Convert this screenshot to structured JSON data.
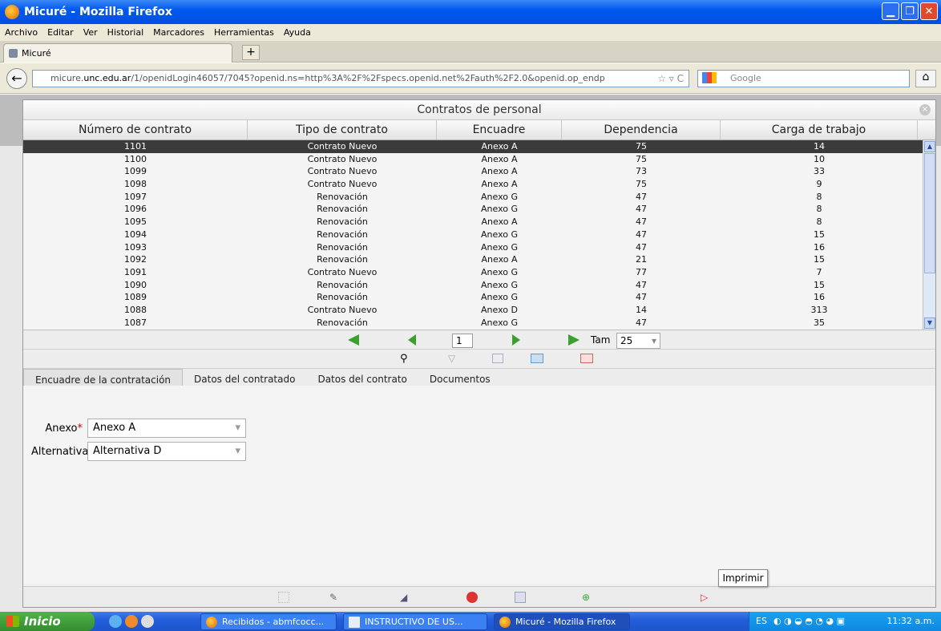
{
  "window": {
    "title": "Micuré - Mozilla Firefox"
  },
  "menu": [
    "Archivo",
    "Editar",
    "Ver",
    "Historial",
    "Marcadores",
    "Herramientas",
    "Ayuda"
  ],
  "browser": {
    "tab_label": "Micuré",
    "new_tab": "+",
    "url_prefix": "micure.",
    "url_domain": "unc.edu.ar",
    "url_rest": "/1/openidLogin46057/7045?openid.ns=http%3A%2F%2Fspecs.openid.net%2Fauth%2F2.0&openid.op_endp",
    "search_placeholder": "Google"
  },
  "dialog": {
    "title": "Contratos de personal",
    "columns": [
      "Número de contrato",
      "Tipo de contrato",
      "Encuadre",
      "Dependencia",
      "Carga de trabajo"
    ],
    "rows": [
      [
        "1101",
        "Contrato Nuevo",
        "Anexo A",
        "75",
        "14"
      ],
      [
        "1100",
        "Contrato Nuevo",
        "Anexo A",
        "75",
        "10"
      ],
      [
        "1099",
        "Contrato Nuevo",
        "Anexo A",
        "73",
        "33"
      ],
      [
        "1098",
        "Contrato Nuevo",
        "Anexo A",
        "75",
        "9"
      ],
      [
        "1097",
        "Renovación",
        "Anexo G",
        "47",
        "8"
      ],
      [
        "1096",
        "Renovación",
        "Anexo G",
        "47",
        "8"
      ],
      [
        "1095",
        "Renovación",
        "Anexo A",
        "47",
        "8"
      ],
      [
        "1094",
        "Renovación",
        "Anexo G",
        "47",
        "15"
      ],
      [
        "1093",
        "Renovación",
        "Anexo G",
        "47",
        "16"
      ],
      [
        "1092",
        "Renovación",
        "Anexo A",
        "21",
        "15"
      ],
      [
        "1091",
        "Contrato Nuevo",
        "Anexo G",
        "77",
        "7"
      ],
      [
        "1090",
        "Renovación",
        "Anexo G",
        "47",
        "15"
      ],
      [
        "1089",
        "Renovación",
        "Anexo G",
        "47",
        "16"
      ],
      [
        "1088",
        "Contrato Nuevo",
        "Anexo D",
        "14",
        "313"
      ],
      [
        "1087",
        "Renovación",
        "Anexo G",
        "47",
        "35"
      ]
    ],
    "pager": {
      "page": "1",
      "size_label": "Tam",
      "size_value": "25"
    },
    "tabs": [
      "Encuadre de la contratación",
      "Datos del contratado",
      "Datos del contrato",
      "Documentos"
    ],
    "form": {
      "anexo_label": "Anexo",
      "anexo_value": "Anexo A",
      "alternativa_label": "Alternativa",
      "alternativa_value": "Alternativa D",
      "required_mark": "*"
    },
    "tooltip": "Imprimir"
  },
  "taskbar": {
    "start": "Inicio",
    "buttons": [
      "Recibidos - abmfcocc...",
      "INSTRUCTIVO DE US...",
      "Micuré - Mozilla Firefox"
    ],
    "lang": "ES",
    "clock": "11:32 a.m."
  }
}
